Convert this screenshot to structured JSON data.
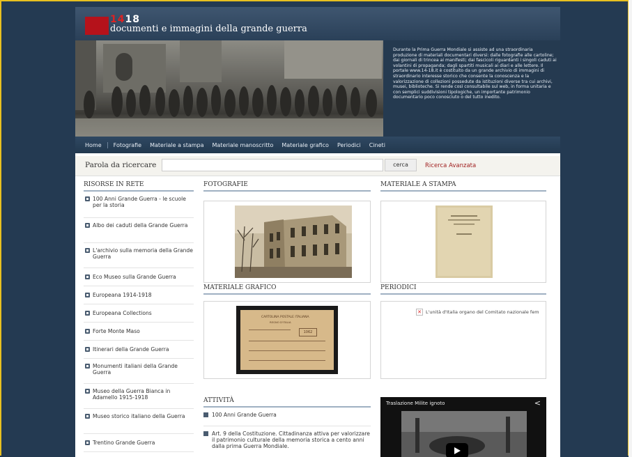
{
  "header": {
    "logo_number_red": "14",
    "logo_number_white": "18",
    "site_title": "documenti e immagini della grande guerra"
  },
  "hero": {
    "description": "Durante la Prima Guerra Mondiale si assiste ad una straordinaria produzione di materiali documentari diversi: dalle fotografie alle cartoline; dai giornali di trincea ai manifesti; dai fascicoli riguardanti i singoli caduti ai volantini di propaganda; dagli spartiti musicali ai diari e alle lettere. Il portale www.14-18.it è costituito da un grande archivio di immagini di straordinario interesse storico che consente la conoscenza e la valorizzazione di collezioni possedute da istituzioni diverse tra cui archivi, musei, biblioteche. Si rende così consultabile sul web, in forma unitaria e con semplici suddivisioni tipologiche, un importante patrimonio documentario poco conosciuto o del tutto inedito."
  },
  "nav": {
    "items": [
      "Home",
      "Fotografie",
      "Materiale a stampa",
      "Materiale manoscritto",
      "Materiale grafico",
      "Periodici",
      "Cineti"
    ]
  },
  "search": {
    "label": "Parola da ricercare",
    "value": "",
    "button": "cerca",
    "advanced": "Ricerca Avanzata"
  },
  "sidebar": {
    "title": "RISORSE IN RETE",
    "items": [
      "100 Anni Grande Guerra - le scuole per la storia",
      "Albo dei caduti della Grande Guerra",
      "L'archivio sulla memoria della Grande Guerra",
      "Eco Museo sulla Grande Guerra",
      "Europeana 1914-1918",
      "Europeana Collections",
      "Forte Monte Maso",
      "Itinerari della Grande Guerra",
      "Monumenti italiani della Grande Guerra",
      "Museo della Guerra Bianca in Adamello 1915-1918",
      "Museo storico italiano della Guerra",
      "Trentino Grande Guerra"
    ]
  },
  "sections": {
    "fotografie": "FOTOGRAFIE",
    "materiale_stampa": "MATERIALE A STAMPA",
    "materiale_grafico": "MATERIALE GRAFICO",
    "periodici": "PERIODICI",
    "attivita": "ATTIVITÀ"
  },
  "periodici": {
    "item": "L'unità d'Italia   organo del Comitato nazionale fem"
  },
  "postcard": {
    "line1": "CARTOLINA POSTALE ITALIANA",
    "line2": "REGNO D'ITALIA",
    "stamp": "1062"
  },
  "attivita": {
    "items": [
      "100 Anni Grande Guerra",
      "Art. 9 della Costituzione. Cittadinanza attiva per valorizzare il patrimonio culturale della memoria storica a cento anni dalla prima Guerra Mondiale."
    ]
  },
  "video": {
    "title": "Traslazione Milite ignoto"
  },
  "colors": {
    "accent": "#b5121b",
    "background": "#243a52",
    "frame": "#e8c020"
  }
}
